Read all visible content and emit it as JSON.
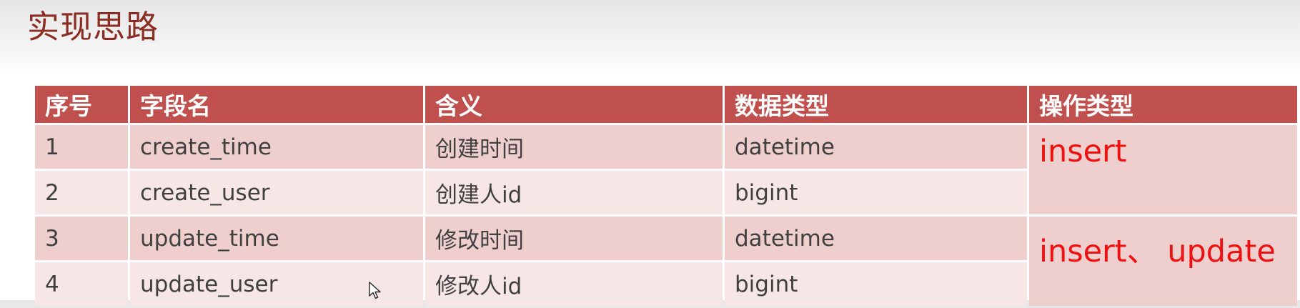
{
  "title": "实现思路",
  "table": {
    "headers": [
      "序号",
      "字段名",
      "含义",
      "数据类型",
      "操作类型"
    ],
    "rows": [
      {
        "index": "1",
        "field": "create_time",
        "meaning": "创建时间",
        "type": "datetime"
      },
      {
        "index": "2",
        "field": "create_user",
        "meaning": "创建人id",
        "type": "bigint"
      },
      {
        "index": "3",
        "field": "update_time",
        "meaning": "修改时间",
        "type": "datetime"
      },
      {
        "index": "4",
        "field": "update_user",
        "meaning": "修改人id",
        "type": "bigint"
      }
    ],
    "operations": [
      "insert",
      "insert、 update"
    ]
  },
  "colors": {
    "title": "#8b2d22",
    "header_bg": "#c0504d",
    "row_dark": "#efcfce",
    "row_light": "#f7e6e6",
    "operation_text": "#ee1111"
  },
  "icons": [
    "mouse-cursor-icon"
  ]
}
